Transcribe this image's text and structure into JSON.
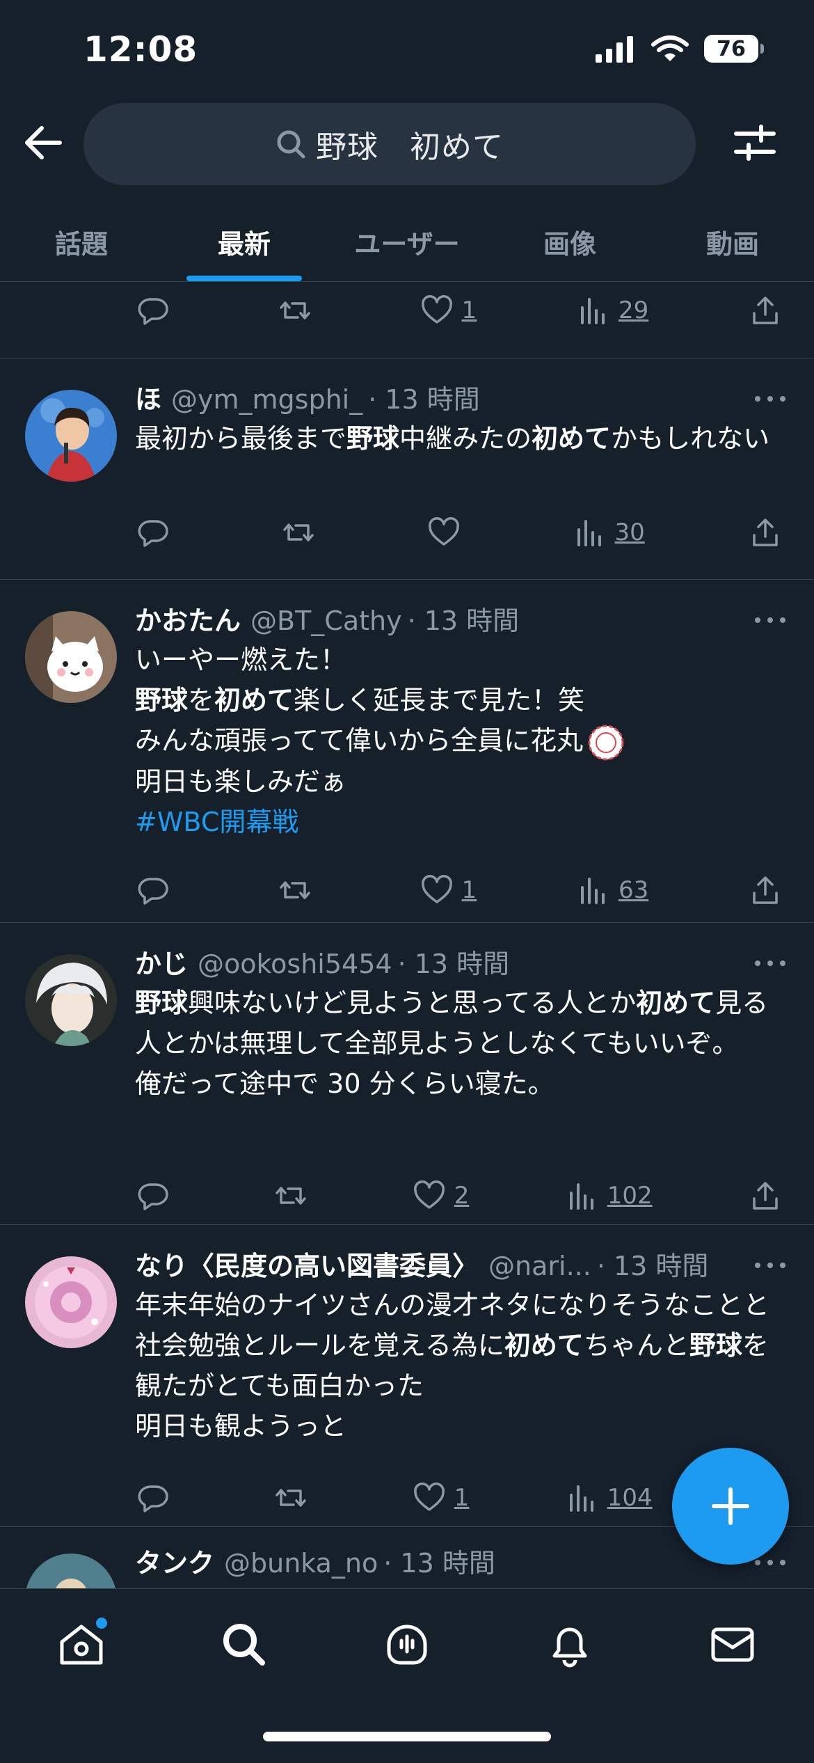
{
  "status_bar": {
    "time": "12:08",
    "battery": "76"
  },
  "search": {
    "query": "野球　初めて"
  },
  "tabs": [
    {
      "label": "話題",
      "active": false
    },
    {
      "label": "最新",
      "active": true
    },
    {
      "label": "ユーザー",
      "active": false
    },
    {
      "label": "画像",
      "active": false
    },
    {
      "label": "動画",
      "active": false
    }
  ],
  "top_partial": {
    "likes": "1",
    "views": "29"
  },
  "tweets": [
    {
      "name": "ほ",
      "handle": "@ym_mgsphi_",
      "time": "· 13 時間",
      "text_parts": [
        {
          "t": "最初から最後まで"
        },
        {
          "t": "野球",
          "b": true
        },
        {
          "t": "中継みたの"
        },
        {
          "t": "初めて",
          "b": true
        },
        {
          "t": "かもしれない"
        }
      ],
      "likes": "",
      "views": "30"
    },
    {
      "name": "かおたん",
      "handle": "@BT_Cathy",
      "time": "· 13 時間",
      "line1": "いーやー燃えた！",
      "line2_parts": [
        {
          "t": "野球",
          "b": true
        },
        {
          "t": "を"
        },
        {
          "t": "初めて",
          "b": true
        },
        {
          "t": "楽しく延長まで見た！笑"
        }
      ],
      "line3": "みんな頑張ってて偉いから全員に花丸",
      "line4": "明日も楽しみだぁ",
      "hashtag": "#WBC開幕戦",
      "likes": "1",
      "views": "63"
    },
    {
      "name": "かじ",
      "handle": "@ookoshi5454",
      "time": "· 13 時間",
      "text_parts": [
        {
          "t": "野球",
          "b": true
        },
        {
          "t": "興味ないけど見ようと思ってる人とか"
        },
        {
          "t": "初めて",
          "b": true
        },
        {
          "t": "見る人とかは無理して全部見ようとしなくてもいいぞ。"
        }
      ],
      "line_extra": "俺だって途中で 30 分くらい寝た。",
      "likes": "2",
      "views": "102"
    },
    {
      "name": "なり〈民度の高い図書委員〉",
      "handle": "@nari...",
      "time": "· 13 時間",
      "text_parts": [
        {
          "t": "年末年始のナイツさんの漫才ネタになりそうなことと社会勉強とルールを覚える為に"
        },
        {
          "t": "初めて",
          "b": true
        },
        {
          "t": "ちゃんと"
        },
        {
          "t": "野球",
          "b": true
        },
        {
          "t": "を観たがとても面白かった"
        }
      ],
      "line_extra": "明日も観ようっと",
      "likes": "1",
      "views": "104"
    },
    {
      "name": "タンク",
      "handle": "@bunka_no",
      "time": "· 13 時間"
    }
  ],
  "colors": {
    "background": "#15202b",
    "accent": "#1d9bf0",
    "secondary_text": "#8b98a5",
    "divider": "#38444d"
  },
  "icons": {
    "back": "arrow-left-icon",
    "search": "search-icon",
    "filter": "sliders-icon",
    "reply": "speech-bubble-icon",
    "retweet": "retweet-icon",
    "like": "heart-icon",
    "views": "bar-chart-icon",
    "share": "share-icon",
    "more": "more-dots-icon",
    "compose": "plus-icon",
    "nav": [
      "home-icon",
      "search-icon",
      "spaces-icon",
      "bell-icon",
      "mail-icon"
    ]
  }
}
